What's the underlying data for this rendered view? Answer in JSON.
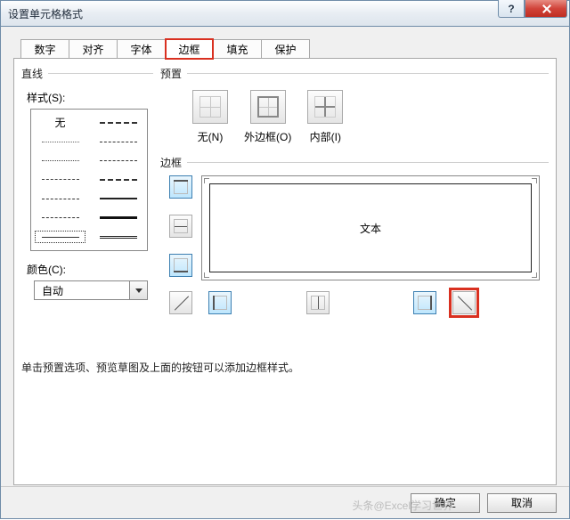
{
  "window": {
    "title": "设置单元格格式",
    "help": "?",
    "close": "×"
  },
  "tabs": [
    "数字",
    "对齐",
    "字体",
    "边框",
    "填充",
    "保护"
  ],
  "active_tab_index": 3,
  "line_section": {
    "header": "直线",
    "style_label": "样式(S):",
    "none_label": "无",
    "color_label": "颜色(C):",
    "color_value": "自动",
    "styles_left": [
      {
        "type": "none"
      },
      {
        "border": "1px dotted #666"
      },
      {
        "border": "1px dotted #444"
      },
      {
        "border": "1px dashed #444"
      },
      {
        "border": "1.5px dashed #333"
      },
      {
        "border": "1px dashed #333",
        "extra": "long"
      },
      {
        "border": "1px solid #333",
        "selected": true
      }
    ],
    "styles_right": [
      {
        "border": "2px dashed #333",
        "pattern": "dash"
      },
      {
        "border": "1px dashed #333",
        "pattern": "dashdot"
      },
      {
        "border": "1px dashed #333",
        "pattern": "wide"
      },
      {
        "border": "2px dashed #333",
        "pattern": "dashdot2"
      },
      {
        "border": "2px solid #222"
      },
      {
        "border": "3px solid #111"
      },
      {
        "border": "3px double #222"
      }
    ]
  },
  "preset_section": {
    "header": "预置",
    "items": [
      {
        "label": "无(N)",
        "icon": "grid4"
      },
      {
        "label": "外边框(O)",
        "icon": "outline"
      },
      {
        "label": "内部(I)",
        "icon": "inside"
      }
    ]
  },
  "border_section": {
    "header": "边框",
    "preview_text": "文本",
    "side_buttons": [
      {
        "name": "border-top-button",
        "selected": true,
        "edges": [
          "t"
        ]
      },
      {
        "name": "border-horizontal-button",
        "selected": false,
        "edges": [
          "h"
        ]
      },
      {
        "name": "border-bottom-button",
        "selected": true,
        "edges": [
          "b"
        ]
      }
    ],
    "bottom_buttons": [
      {
        "name": "border-diag-up-button",
        "selected": false,
        "diag": 2
      },
      {
        "name": "border-left-button",
        "selected": true,
        "edges": [
          "l"
        ]
      },
      {
        "name": "border-vertical-button",
        "selected": false,
        "edges": [
          "v"
        ]
      },
      {
        "name": "border-right-button",
        "selected": true,
        "edges": [
          "r"
        ]
      },
      {
        "name": "border-diag-down-button",
        "selected": false,
        "diag": 1,
        "highlighted": true
      }
    ]
  },
  "hint_text": "单击预置选项、预览草图及上面的按钮可以添加边框样式。",
  "footer": {
    "ok": "确定",
    "cancel": "取消"
  },
  "watermark": "头条@Excel学习世界"
}
